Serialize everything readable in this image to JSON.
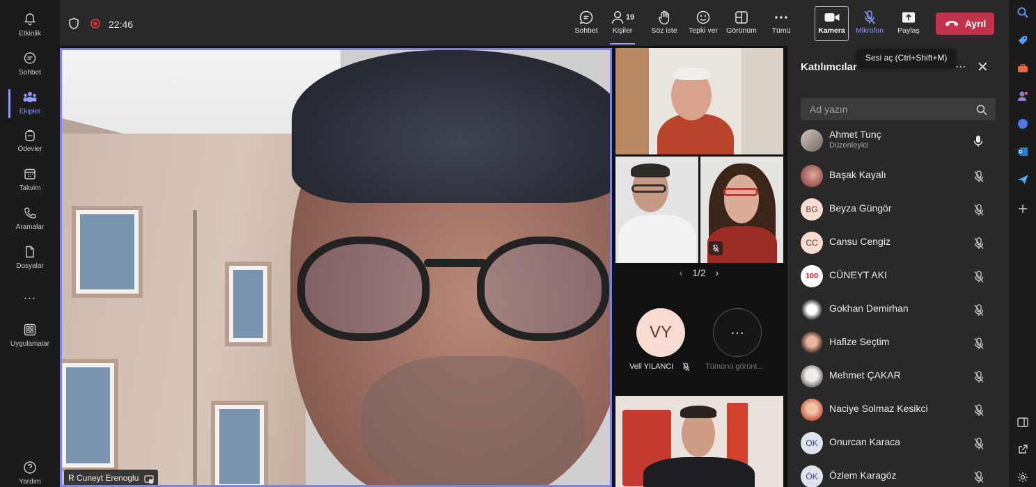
{
  "rail": {
    "items": [
      {
        "label": "Etkinlik",
        "icon": "bell-icon"
      },
      {
        "label": "Sohbet",
        "icon": "chat-icon"
      },
      {
        "label": "Ekipler",
        "icon": "teams-icon"
      },
      {
        "label": "Ödevler",
        "icon": "backpack-icon"
      },
      {
        "label": "Takvim",
        "icon": "calendar-icon"
      },
      {
        "label": "Aramalar",
        "icon": "phone-icon"
      },
      {
        "label": "Dosyalar",
        "icon": "file-icon"
      },
      {
        "label": "...",
        "icon": "more-icon"
      },
      {
        "label": "Uygulamalar",
        "icon": "apps-icon"
      }
    ],
    "help": "Yardım"
  },
  "meeting": {
    "timer": "22:46"
  },
  "toolbar": {
    "chat": "Sohbet",
    "people": "Kişiler",
    "people_count": "19",
    "raise_hand": "Söz iste",
    "react": "Tepki ver",
    "view": "Görünüm",
    "more": "Tümü",
    "camera": "Kamera",
    "mic": "Mikrofon",
    "share": "Paylaş",
    "leave": "Ayrıl"
  },
  "tooltip": "Sesi aç (Ctrl+Shift+M)",
  "stage": {
    "main_name": "R Cuneyt Erenoglu",
    "pager": "1/2",
    "veli_initials": "VY",
    "veli_name": "Veli YILANCI",
    "view_all": "Tümünü görünt..."
  },
  "panel": {
    "title": "Katılımcılar",
    "search_placeholder": "Ad yazın",
    "participants": [
      {
        "name": "Ahmet Tunç",
        "role": "Düzenleyici",
        "initials": ""
      },
      {
        "name": "Başak Kayalı",
        "initials": ""
      },
      {
        "name": "Beyza Güngör",
        "initials": "BG"
      },
      {
        "name": "Cansu Cengiz",
        "initials": "CC"
      },
      {
        "name": "CÜNEYT AKI",
        "initials": "100"
      },
      {
        "name": "Gokhan Demirhan",
        "initials": ""
      },
      {
        "name": "Hafize Seçtim",
        "initials": ""
      },
      {
        "name": "Mehmet ÇAKAR",
        "initials": ""
      },
      {
        "name": "Naciye Solmaz Kesikci",
        "initials": ""
      },
      {
        "name": "Onurcan Karaca",
        "initials": "OK"
      },
      {
        "name": "Özlem Karagöz",
        "initials": "ÖK"
      }
    ]
  },
  "colors": {
    "accent": "#7b83eb",
    "leave": "#c4314b",
    "recording": "#d13438"
  }
}
